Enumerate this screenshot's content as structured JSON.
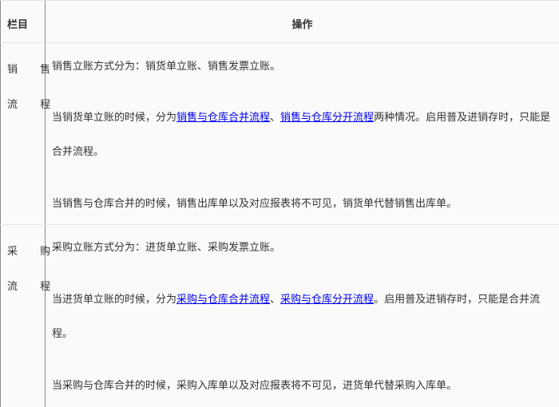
{
  "header": {
    "col_category": "栏目",
    "col_operation": "操作"
  },
  "sections": [
    {
      "category_line1": "销 售",
      "category_line2": "流 程",
      "p1": "销售立账方式分为：销货单立账、销售发票立账。",
      "p2_prefix": "当销货单立账的时候，分为",
      "p2_link1": "销售与仓库合并流程",
      "p2_sep": "、",
      "p2_link2": "销售与仓库分开流程",
      "p2_suffix": "两种情况。启用普及进销存时，只能是合并流程。",
      "p3": "当销售与仓库合并的时候，销售出库单以及对应报表将不可见，销货单代替销售出库单。"
    },
    {
      "category_line1": "采 购",
      "category_line2": "流 程",
      "p1": "采购立账方式分为：进货单立账、采购发票立账。",
      "p2_prefix": "当进货单立账的时候，分为",
      "p2_link1": "采购与仓库合并流程",
      "p2_sep": "、",
      "p2_link2": "采购与仓库分开流程",
      "p2_suffix": "。启用普及进销存时，只能是合并流程。",
      "p3": "当采购与仓库合并的时候，采购入库单以及对应报表将不可见，进货单代替采购入库单。"
    }
  ]
}
